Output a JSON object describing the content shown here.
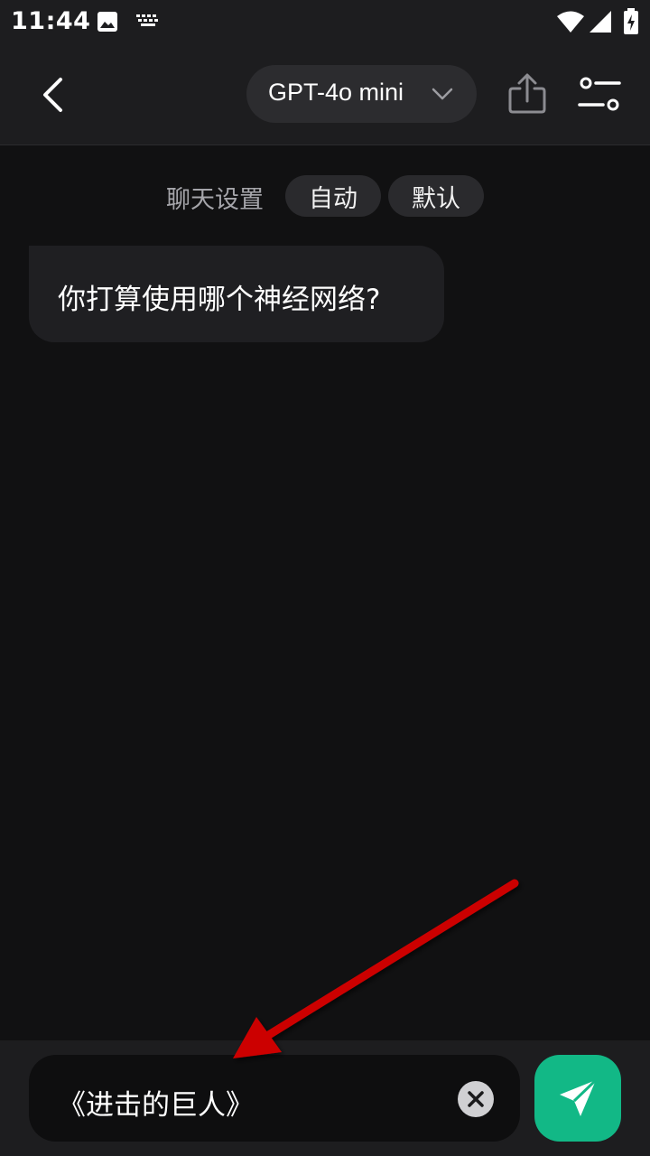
{
  "status_bar": {
    "time": "11:44",
    "icons": [
      "image-icon",
      "keyboard-icon",
      "wifi-icon",
      "signal-icon",
      "battery-charging-icon"
    ]
  },
  "header": {
    "model_name": "GPT-4o mini",
    "icons": [
      "back-arrow-icon",
      "chevron-down-icon",
      "share-icon",
      "settings-sliders-icon"
    ]
  },
  "chat_settings": {
    "label": "聊天设置",
    "chips": [
      "自动",
      "默认"
    ]
  },
  "messages": [
    {
      "text": "你打算使用哪个神经网络?"
    }
  ],
  "input": {
    "value": "《进击的巨人》",
    "icons": [
      "clear-icon",
      "send-icon"
    ]
  },
  "colors": {
    "accent": "#12b886",
    "annotation_arrow": "#cc0000",
    "background": "#111112",
    "surface": "#1d1d1f"
  }
}
